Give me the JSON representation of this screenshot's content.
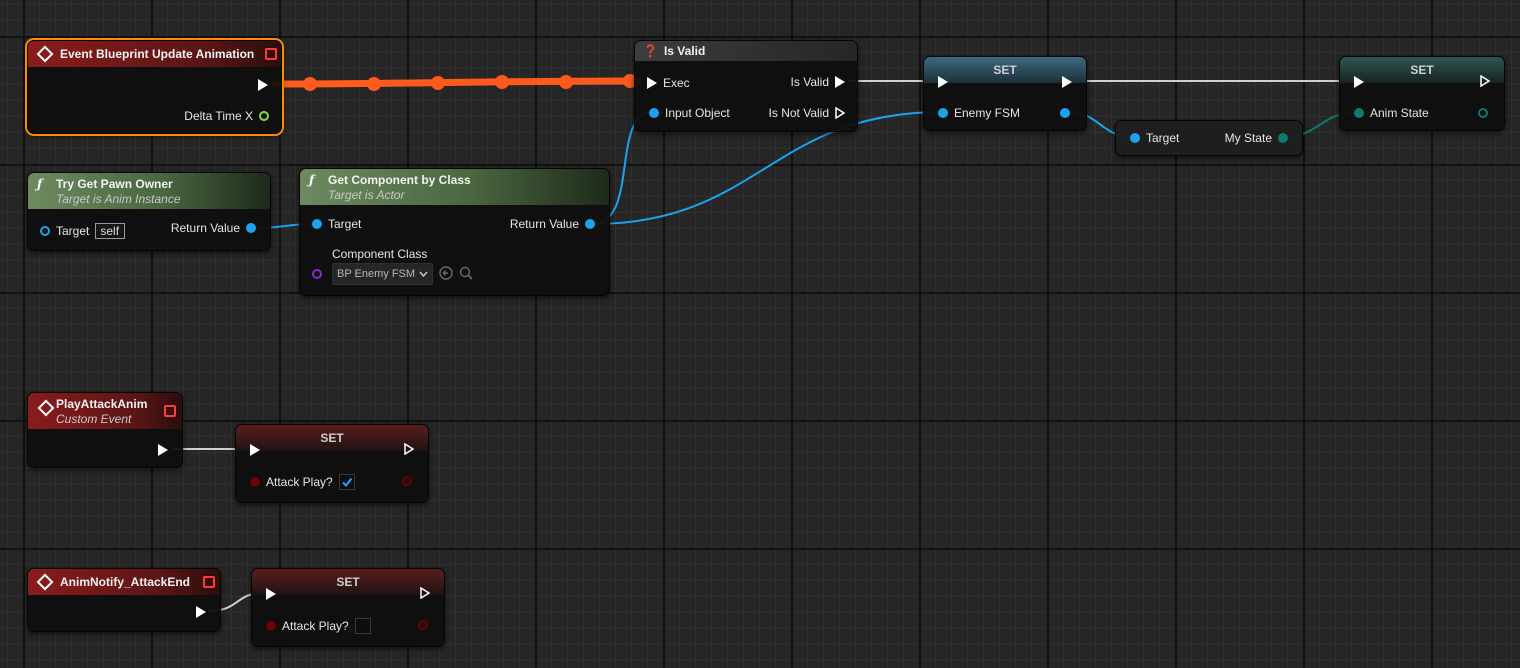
{
  "colors": {
    "exec_active": "#ff5a1e",
    "object_pin": "#1ba3f0",
    "enum_pin": "#0d7a70",
    "float_pin": "#8bdb3a",
    "bool_pin": "#700000",
    "class_pin": "#7e2bd8",
    "event_header": "#8a1c1c",
    "function_header": "#6e8a60"
  },
  "nodes": {
    "update_event": {
      "title": "Event Blueprint Update Animation",
      "delta_label": "Delta Time X"
    },
    "is_valid": {
      "title": "Is Valid",
      "exec_label": "Exec",
      "input_label": "Input Object",
      "valid_label": "Is Valid",
      "not_valid_label": "Is Not Valid",
      "icon": "question-icon"
    },
    "set_enemy_fsm": {
      "title": "SET",
      "var_label": "Enemy FSM"
    },
    "get_my_state": {
      "target_label": "Target",
      "output_label": "My State"
    },
    "set_anim_state": {
      "title": "SET",
      "var_label": "Anim State"
    },
    "try_get_pawn": {
      "title": "Try Get Pawn Owner",
      "subtitle": "Target is Anim Instance",
      "target_label": "Target",
      "target_value": "self",
      "return_label": "Return Value"
    },
    "get_component": {
      "title": "Get Component by Class",
      "subtitle": "Target is Actor",
      "target_label": "Target",
      "return_label": "Return Value",
      "class_label": "Component Class",
      "class_value": "BP Enemy FSM"
    },
    "play_attack_event": {
      "title": "PlayAttackAnim",
      "subtitle": "Custom Event"
    },
    "set_attack_true": {
      "title": "SET",
      "var_label": "Attack Play?",
      "checked": true
    },
    "attack_end_event": {
      "title": "AnimNotify_AttackEnd"
    },
    "set_attack_false": {
      "title": "SET",
      "var_label": "Attack Play?",
      "checked": false
    }
  }
}
